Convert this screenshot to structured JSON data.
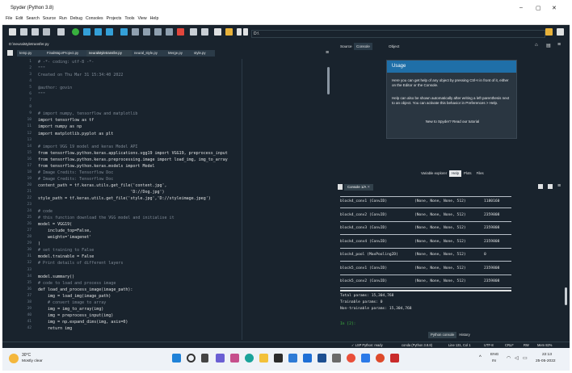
{
  "window": {
    "title": "Spyder (Python 3.8)",
    "minimize": "–",
    "maximize": "▢",
    "close": "✕"
  },
  "menu": [
    "File",
    "Edit",
    "Search",
    "Source",
    "Run",
    "Debug",
    "Consoles",
    "Projects",
    "Tools",
    "View",
    "Help"
  ],
  "toolbar": {
    "path": "D:\\"
  },
  "editor": {
    "file_path": "D:\\neuralstyletransfer.py",
    "tabs": [
      "temp.py",
      "FinalMajorProject.py",
      "neuralstyletransfer.py",
      "neural_style.py",
      "Merge.py",
      "style.py"
    ],
    "active_tab": 2,
    "lines": [
      "# -*- coding: utf-8 -*-",
      "\"\"\"",
      "Created on Thu Mar 31 15:34:40 2022",
      "",
      "@author: govin",
      "\"\"\"",
      "",
      "",
      "# import numpy, tensorflow and matplotlib",
      "import tensorflow as tf",
      "import numpy as np",
      "import matplotlib.pyplot as plt",
      "",
      "# import VGG 19 model and keras Model API",
      "from tensorflow.python.keras.applications.vgg19 import VGG19, preprocess_input",
      "from tensorflow.python.keras.preprocessing.image import load_img, img_to_array",
      "from tensorflow.python.keras.models import Model",
      "# Image Credits: Tensorflow Doc",
      "# Image Credits: Tensorflow Doc",
      "content_path = tf.keras.utils.get_file('content.jpg',",
      "                                      'D://Dog.jpg')",
      "style_path = tf.keras.utils.get_file('style.jpg','D://styleimage.jpeg')",
      "",
      "# code",
      "# this function download the VGG model and initialise it",
      "model = VGG19(",
      "    include_top=False,",
      "    weights='imagenet'",
      ")",
      "# set training to False",
      "model.trainable = False",
      "# Print details of different layers",
      "",
      "model.summary()",
      "# code to load and process image",
      "def load_and_process_image(image_path):",
      "    img = load_img(image_path)",
      "    # convert image to array",
      "    img = img_to_array(img)",
      "    img = preprocess_input(img)",
      "    img = np.expand_dims(img, axis=0)",
      "    return img"
    ]
  },
  "help_pane": {
    "tabs": [
      "Source",
      "Console",
      "Object"
    ],
    "usage_title": "Usage",
    "usage_p1": "Here you can get help of any object by pressing Ctrl+I in front of it, either on the Editor or the Console.",
    "usage_p2": "Help can also be shown automatically after writing a left parenthesis next to an object. You can activate this behavior in Preferences > Help.",
    "usage_p3": "New to Spyder? Read our tutorial",
    "bottom_tabs": [
      "Variable explorer",
      "Help",
      "Plots",
      "Files"
    ],
    "active_bottom_tab": 1
  },
  "console": {
    "tab": "Console 1/A",
    "rows": [
      {
        "layer": "block4_conv1 (Conv2D)",
        "shape": "(None, None, None, 512)",
        "params": "1180160"
      },
      {
        "layer": "block4_conv2 (Conv2D)",
        "shape": "(None, None, None, 512)",
        "params": "2359808"
      },
      {
        "layer": "block4_conv3 (Conv2D)",
        "shape": "(None, None, None, 512)",
        "params": "2359808"
      },
      {
        "layer": "block4_conv4 (Conv2D)",
        "shape": "(None, None, None, 512)",
        "params": "2359808"
      },
      {
        "layer": "block4_pool (MaxPooling2D)",
        "shape": "(None, None, None, 512)",
        "params": "0"
      },
      {
        "layer": "block5_conv1 (Conv2D)",
        "shape": "(None, None, None, 512)",
        "params": "2359808"
      },
      {
        "layer": "block5_conv2 (Conv2D)",
        "shape": "(None, None, None, 512)",
        "params": "2359808"
      }
    ],
    "totals": [
      "Total params: 15,304,768",
      "Trainable params: 0",
      "Non-trainable params: 15,304,768"
    ],
    "prompt": "In [2]:",
    "bottom_tabs": [
      "Python console",
      "History"
    ]
  },
  "statusbar": {
    "lsp": "✓ LSP Python: ready",
    "env": "conda (Python 3.8.8)",
    "position": "Line 131, Col 1",
    "encoding": "UTF-8",
    "eol": "CRLF",
    "perm": "RW",
    "mem": "Mem 82%"
  },
  "taskbar": {
    "weather_temp": "30°C",
    "weather_desc": "Mostly clear",
    "lang": "ENG",
    "region": "IN",
    "time": "22:13",
    "date": "25-05-2022"
  }
}
